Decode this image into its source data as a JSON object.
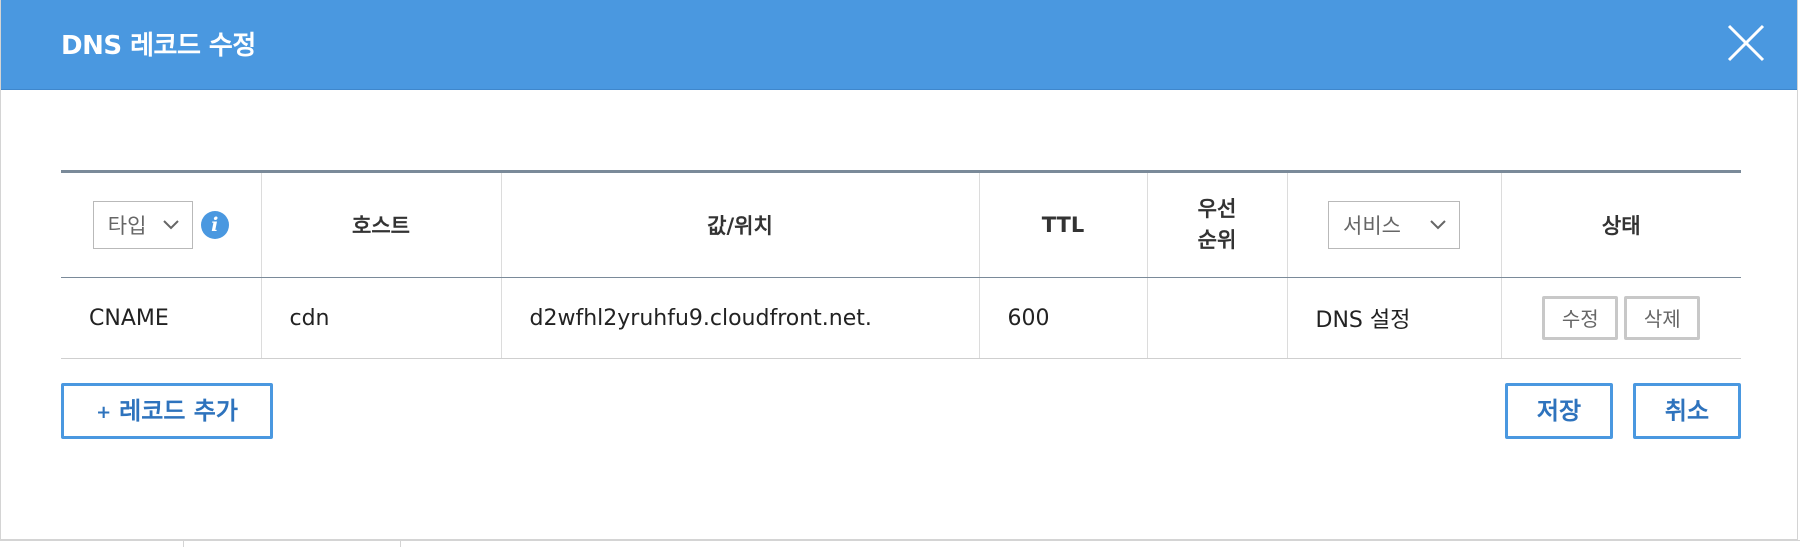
{
  "dialog": {
    "title": "DNS 레코드 수정",
    "close_icon": "close-icon"
  },
  "table": {
    "headers": {
      "type_select": "타입",
      "host": "호스트",
      "value": "값/위치",
      "ttl": "TTL",
      "priority_line1": "우선",
      "priority_line2": "순위",
      "service_select": "서비스",
      "status": "상태"
    },
    "rows": [
      {
        "type": "CNAME",
        "host": "cdn",
        "value": "d2wfhl2yruhfu9.cloudfront.net.",
        "ttl": "600",
        "priority": "",
        "service": "DNS 설정",
        "edit_label": "수정",
        "delete_label": "삭제"
      }
    ]
  },
  "footer": {
    "add_label": "레코드 추가",
    "add_icon": "plus-icon",
    "save_label": "저장",
    "cancel_label": "취소"
  },
  "colors": {
    "header_bg": "#4a98e0",
    "accent": "#2e73bd"
  }
}
